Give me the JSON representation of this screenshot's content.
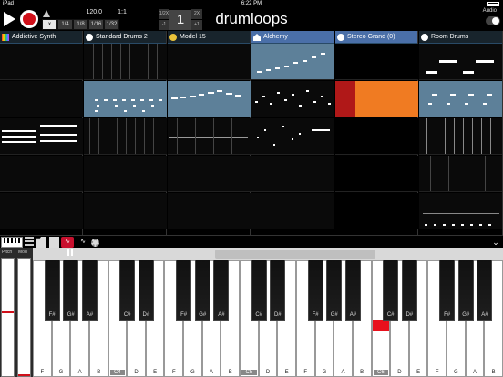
{
  "status_bar": {
    "carrier": "iPad",
    "time": "6:22 PM"
  },
  "transport": {
    "tempo": "120.0",
    "position": "1:1",
    "bar_number": "1",
    "bar_up": "1/2X",
    "bar_down": "-1",
    "bar_x2": "2X",
    "bar_plus": "+1",
    "quantize": [
      {
        "label": "x",
        "active": true
      },
      {
        "label": "1/4",
        "active": false
      },
      {
        "label": "1/8",
        "active": false
      },
      {
        "label": "1/16",
        "active": false
      },
      {
        "label": "1/32",
        "active": false
      }
    ]
  },
  "app": {
    "title": "drumloops",
    "audio_label": "Audio"
  },
  "tracks": [
    {
      "name": "Addictive Synth",
      "icon": "rainbow-icon",
      "selected": false
    },
    {
      "name": "Standard Drums 2",
      "icon": "gear-icon",
      "selected": false
    },
    {
      "name": "Model 15",
      "icon": "dial-icon",
      "selected": false
    },
    {
      "name": "Alchemy",
      "icon": "home-icon",
      "selected": false
    },
    {
      "name": "Stereo Grand (0)",
      "icon": "gear-icon",
      "selected": true
    },
    {
      "name": "Room Drums",
      "icon": "gear-icon",
      "selected": false
    }
  ],
  "colors": {
    "accent_red": "#d0101a",
    "clip_blue": "#5d8099",
    "clip_orange": "#f07b22",
    "header_selected": "#4a6fa8"
  },
  "keyboard": {
    "pitch_label": "Pitch",
    "mod_label": "Mod",
    "black_keys": [
      "F#",
      "G#",
      "A#",
      "C#",
      "D#",
      "F#",
      "G#",
      "A#",
      "C#",
      "D#",
      "F#",
      "G#",
      "A#",
      "C#",
      "D#",
      "F#",
      "G#",
      "A#"
    ],
    "white_keys": [
      "F",
      "G",
      "A",
      "B",
      "C4",
      "D",
      "E",
      "F",
      "G",
      "A",
      "B",
      "C5",
      "D",
      "E",
      "F",
      "G",
      "A",
      "B",
      "C6",
      "D",
      "E",
      "F",
      "G",
      "A",
      "B"
    ]
  }
}
